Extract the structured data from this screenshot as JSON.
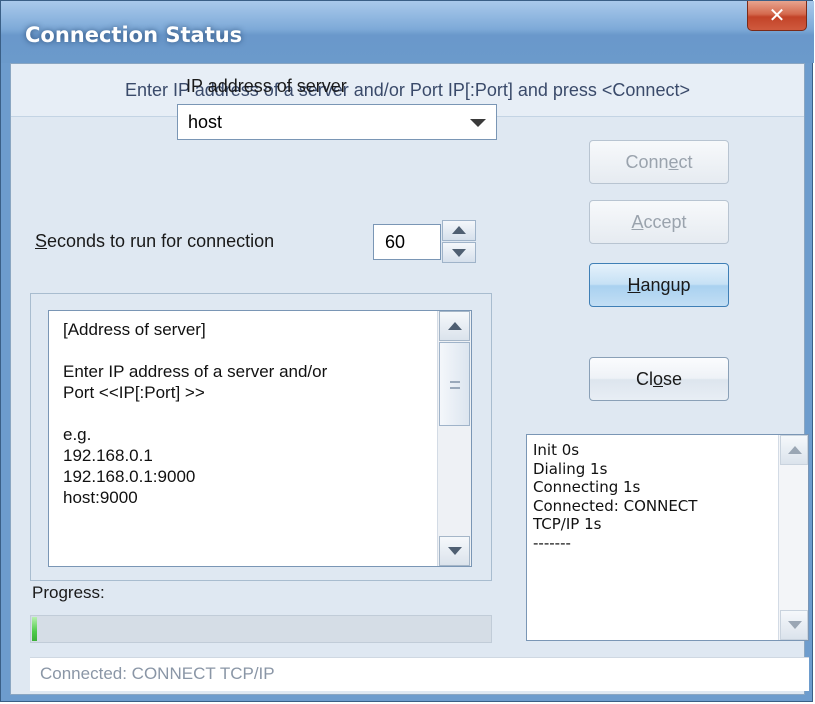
{
  "window": {
    "title": "Connection Status",
    "close_label": "✕"
  },
  "hint_text": "Enter IP address of a server and/or Port IP[:Port] and press <Connect>",
  "ip_address": {
    "label": "IP address of server",
    "value": "host"
  },
  "seconds": {
    "label_accel": "S",
    "label_rest": "econds to run for connection",
    "value": "60"
  },
  "help_text": {
    "lines": [
      "[Address of server]",
      "",
      "Enter IP address of a server and/or",
      "Port <<IP[:Port] >>",
      "",
      "e.g.",
      "192.168.0.1",
      "192.168.0.1:9000",
      "host:9000"
    ]
  },
  "buttons": {
    "connect": {
      "pre": "Conn",
      "accel": "e",
      "post": "ct",
      "enabled": false
    },
    "accept": {
      "pre": "",
      "accel": "A",
      "post": "ccept",
      "enabled": false
    },
    "hangup": {
      "pre": "",
      "accel": "H",
      "post": "angup",
      "enabled": true
    },
    "close": {
      "pre": "Cl",
      "accel": "o",
      "post": "se",
      "enabled": true
    }
  },
  "progress": {
    "label": "Progress:",
    "value_percent": 1
  },
  "log": {
    "lines": [
      "Init 0s",
      "Dialing 1s",
      "Connecting 1s",
      "Connected: CONNECT",
      "TCP/IP 1s",
      "-------"
    ]
  },
  "status_text": "Connected: CONNECT TCP/IP",
  "colors": {
    "titlebar": "#6d9ccd",
    "client_bg": "#dfe8f2",
    "close_button": "#c24328",
    "default_button": "#a9d1f0",
    "progress_fill": "#4fcb4a"
  },
  "icons": {
    "close": "close-x-icon",
    "combo_arrow": "chevron-down-icon",
    "spin_up": "spin-up-arrow-icon",
    "spin_down": "spin-down-arrow-icon",
    "scroll_up": "scroll-up-arrow-icon",
    "scroll_down": "scroll-down-arrow-icon"
  }
}
